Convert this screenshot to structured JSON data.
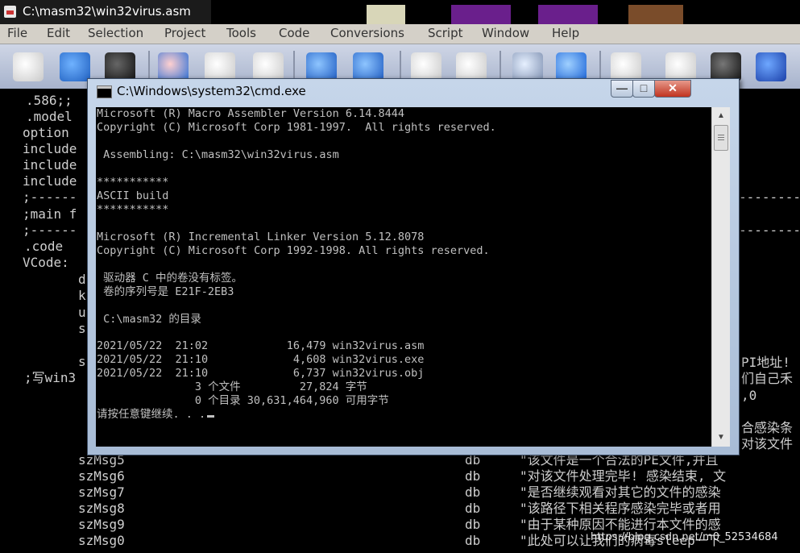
{
  "qeditor": {
    "title": "C:\\masm32\\win32virus.asm",
    "menu": [
      "File",
      "Edit",
      "Selection",
      "Project",
      "Tools",
      "Code",
      "Conversions",
      "Script",
      "Window",
      "Help"
    ],
    "code_lines": {
      "l1": ".586;;",
      "l2": ".model",
      "l3": "option",
      "l4": "include",
      "l5": "include",
      "l6": "include",
      "l7": ";------",
      "l8": ";main f",
      "l9": ";------",
      "l10": ".code",
      "l11": "VCode:",
      "d": "d",
      "k": "k",
      "u": "u",
      "s": "s",
      "s2": "s",
      "wm_comment": ";写win3",
      "right1": "-----------",
      "right2": "-----------",
      "right3": "-----------",
      "api_text": "PI地址!",
      "own_text": "们自己禾",
      "zero_text": ",0",
      "infect_text": "合感染条",
      "file_text": "对该文件",
      "msg5": "szMsg5",
      "msg6": "szMsg6",
      "msg7": "szMsg7",
      "msg8": "szMsg8",
      "msg9": "szMsg9",
      "msg0": "szMsg0",
      "db": "db",
      "str5": "\"该文件是一个合法的PE文件,并且",
      "str6": "\"对该文件处理完毕! 感染结束, 文",
      "str7": "\"是否继续观看对其它的文件的感染",
      "str8": "\"该路径下相关程序感染完毕或者用",
      "str9": "\"由于某种原因不能进行本文件的感",
      "str0": "\"此处可以让我们的病毒sleep一下"
    }
  },
  "cmd": {
    "title": "C:\\Windows\\system32\\cmd.exe",
    "buttons": {
      "min": "—",
      "max": "□",
      "close": "✕"
    },
    "lines": [
      "Microsoft (R) Macro Assembler Version 6.14.8444",
      "Copyright (C) Microsoft Corp 1981-1997.  All rights reserved.",
      "",
      " Assembling: C:\\masm32\\win32virus.asm",
      "",
      "***********",
      "ASCII build",
      "***********",
      "",
      "Microsoft (R) Incremental Linker Version 5.12.8078",
      "Copyright (C) Microsoft Corp 1992-1998. All rights reserved.",
      "",
      " 驱动器 C 中的卷没有标签。",
      " 卷的序列号是 E21F-2EB3",
      "",
      " C:\\masm32 的目录",
      "",
      "2021/05/22  21:02            16,479 win32virus.asm",
      "2021/05/22  21:10             4,608 win32virus.exe",
      "2021/05/22  21:10             6,737 win32virus.obj",
      "               3 个文件         27,824 字节",
      "               0 个目录 30,631,464,960 可用字节",
      "请按任意键继续. . ."
    ]
  },
  "watermark": "https://blog.csdn.net/m0_52534684"
}
